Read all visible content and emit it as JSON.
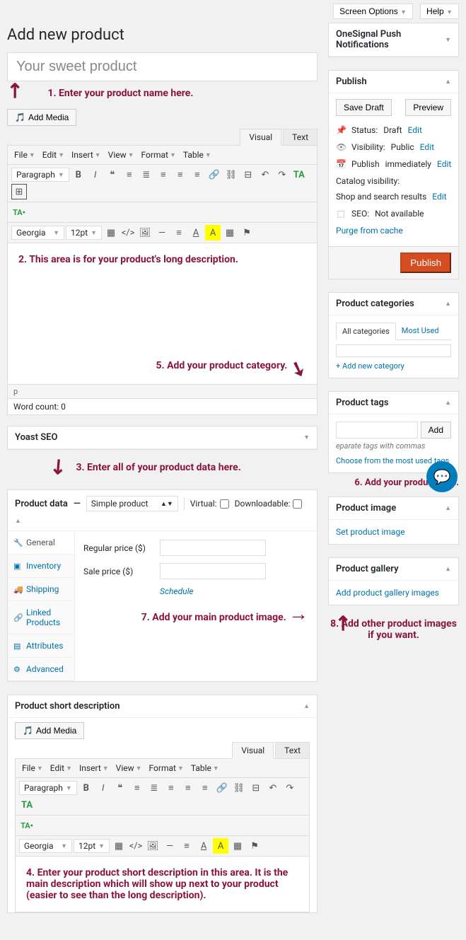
{
  "topbar": {
    "screen_options": "Screen Options",
    "help": "Help"
  },
  "page": {
    "title": "Add new product",
    "title_input": "Your sweet product"
  },
  "annotations": {
    "a1": "1. Enter your product name here.",
    "a2": "2. This area is for your product's long description.",
    "a3": "3. Enter all of your product data here.",
    "a4": "4. Enter your product short description in this area. It is the main description which will show up next to your product (easier to see than the long description).",
    "a5": "5. Add your product category.",
    "a6": "6. Add your product tags.",
    "a7": "7. Add your main product image.",
    "a8": "8. Add other product images if you want."
  },
  "media_btn": "Add Media",
  "editor_tabs": {
    "visual": "Visual",
    "text": "Text"
  },
  "editor_menu": {
    "file": "File",
    "edit": "Edit",
    "insert": "Insert",
    "view": "View",
    "format": "Format",
    "table": "Table"
  },
  "editor_dropdowns": {
    "paragraph": "Paragraph",
    "font": "Georgia",
    "size": "12pt"
  },
  "status": {
    "p": "p",
    "word_count": "Word count: 0"
  },
  "yoast": {
    "title": "Yoast SEO"
  },
  "product_data": {
    "title": "Product data",
    "type": "Simple product",
    "virtual_label": "Virtual:",
    "downloadable_label": "Downloadable:",
    "tabs": {
      "general": "General",
      "inventory": "Inventory",
      "shipping": "Shipping",
      "linked": "Linked Products",
      "attributes": "Attributes",
      "advanced": "Advanced"
    },
    "regular_price": "Regular price ($)",
    "sale_price": "Sale price ($)",
    "schedule": "Schedule"
  },
  "short_desc": {
    "title": "Product short description"
  },
  "onesignal": {
    "title": "OneSignal Push Notifications"
  },
  "publish": {
    "title": "Publish",
    "save_draft": "Save Draft",
    "preview": "Preview",
    "status_label": "Status:",
    "status_value": "Draft",
    "visibility_label": "Visibility:",
    "visibility_value": "Public",
    "publish_label": "Publish",
    "publish_value": "immediately",
    "catalog_label": "Catalog visibility:",
    "catalog_value": "Shop and search results",
    "seo_label": "SEO:",
    "seo_value": "Not available",
    "edit": "Edit",
    "purge": "Purge from cache",
    "publish_btn": "Publish"
  },
  "categories": {
    "title": "Product categories",
    "all": "All categories",
    "most_used": "Most Used",
    "add_new": "+ Add new category"
  },
  "tags": {
    "title": "Product tags",
    "add": "Add",
    "note": "eparate tags with commas",
    "choose": "Choose from the most used tags"
  },
  "product_image": {
    "title": "Product image",
    "set": "Set product image"
  },
  "gallery": {
    "title": "Product gallery",
    "add": "Add product gallery images"
  }
}
